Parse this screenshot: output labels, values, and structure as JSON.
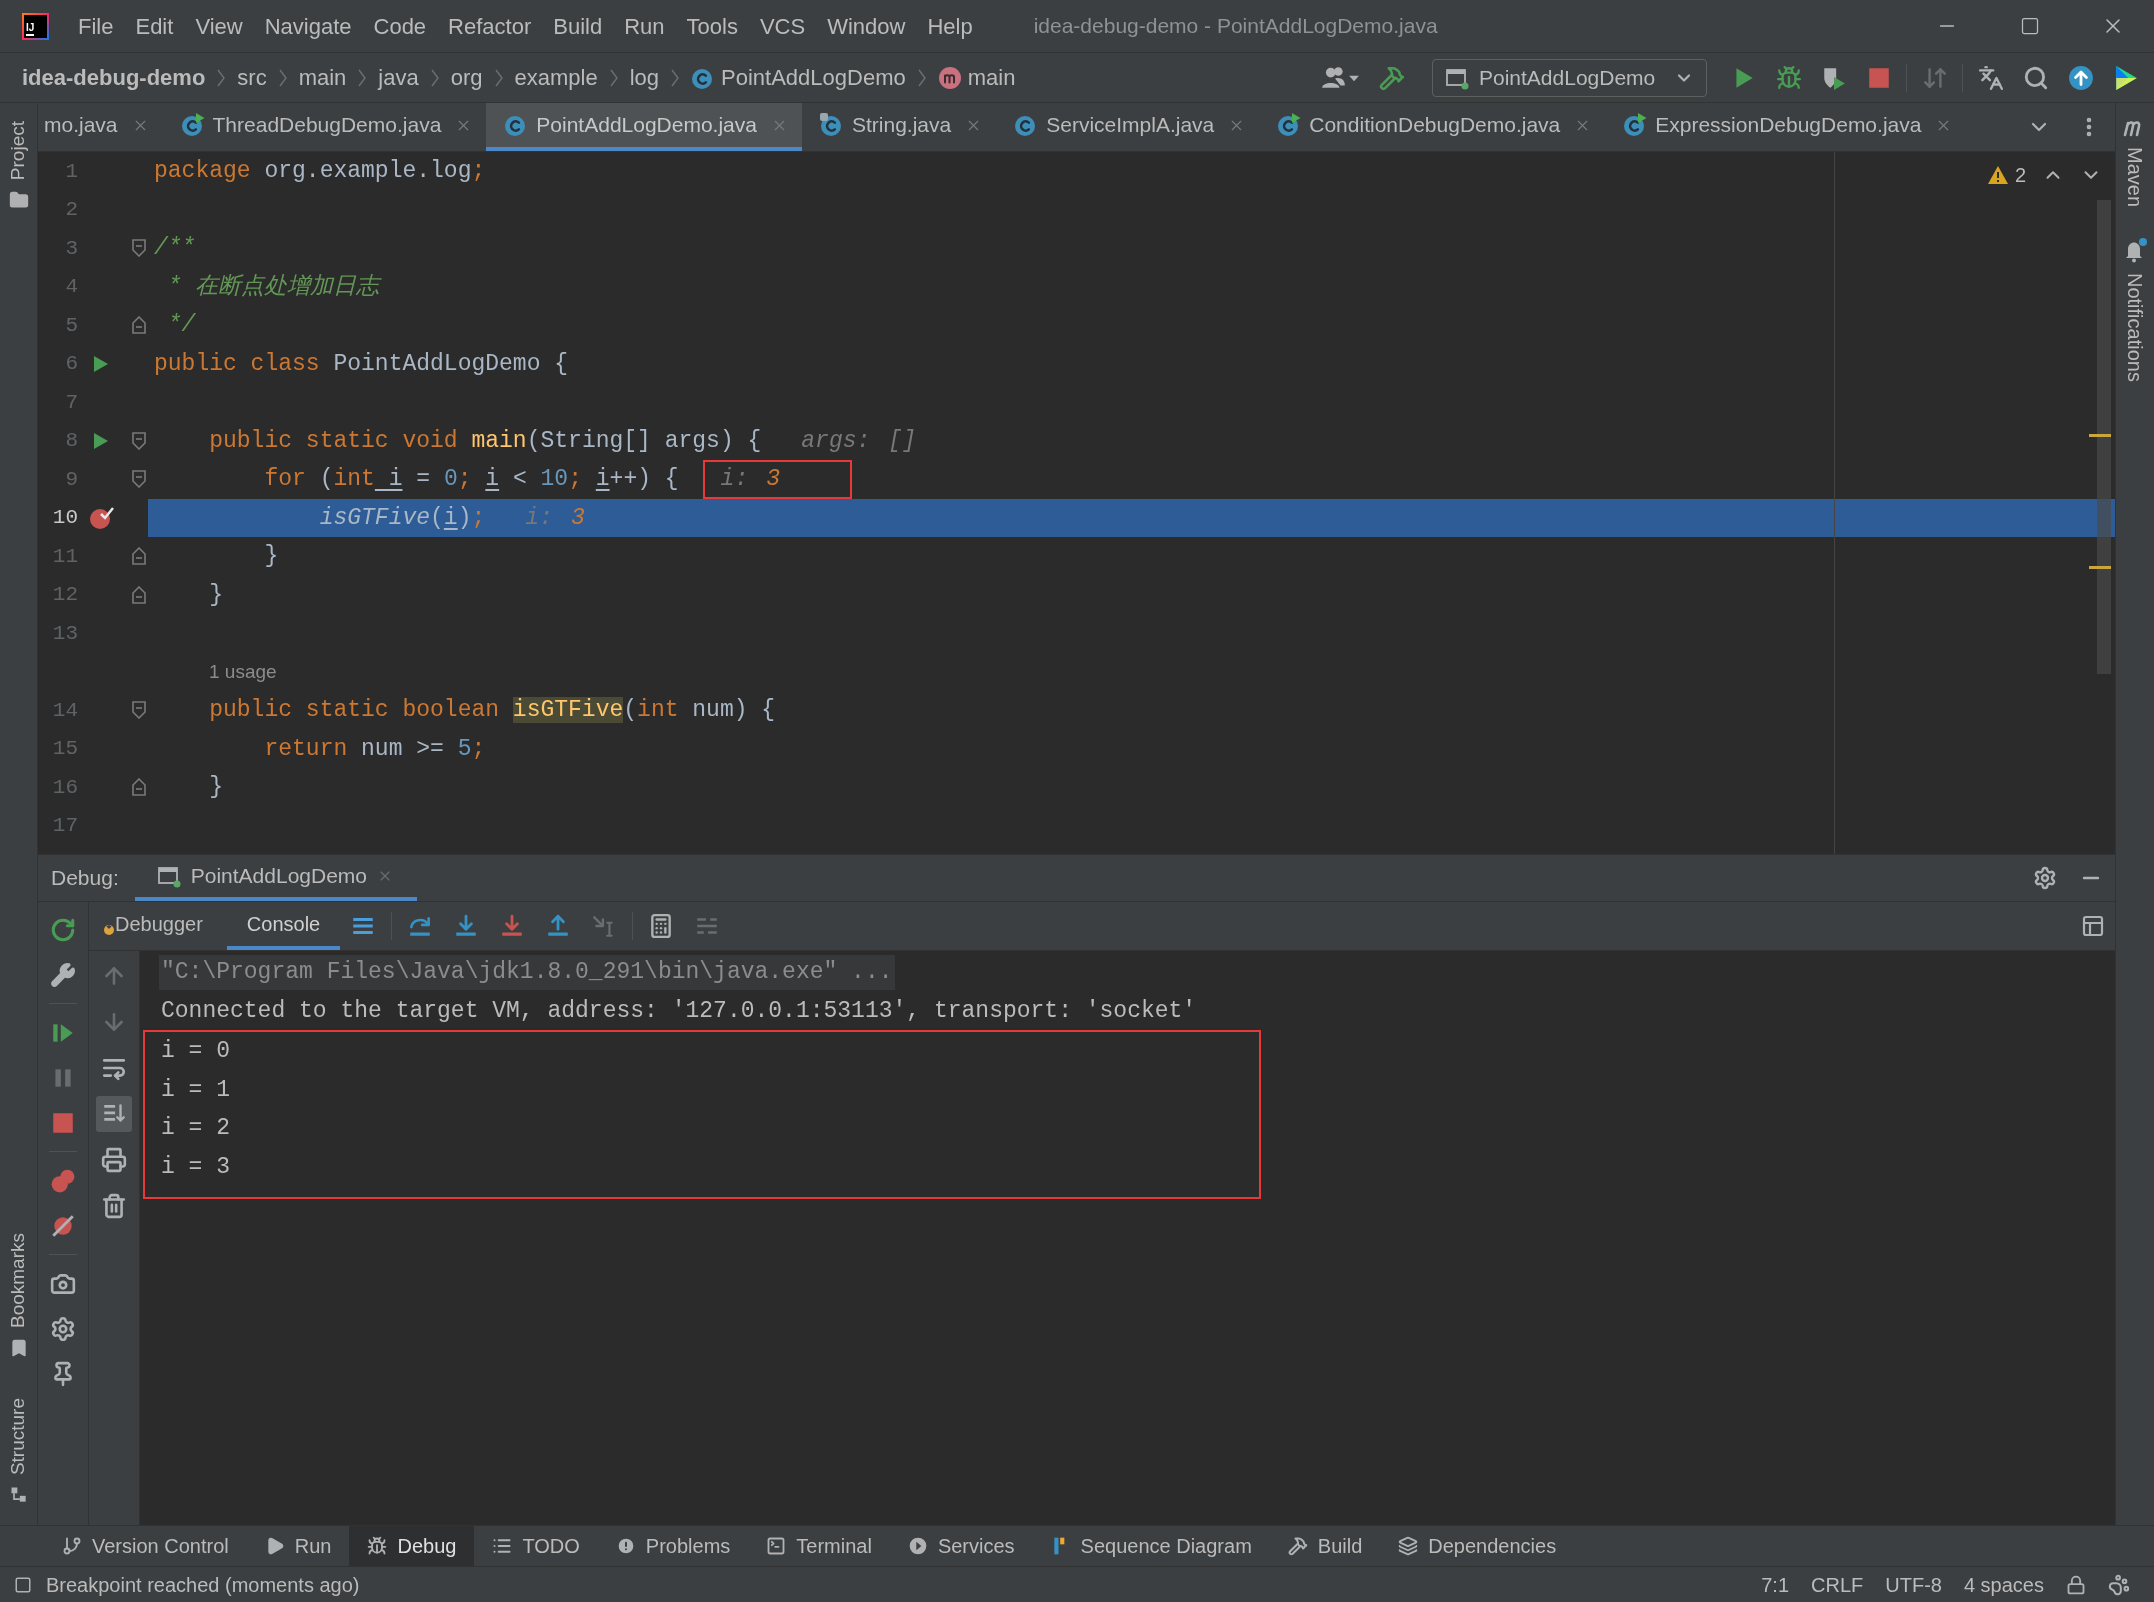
{
  "app": {
    "logo_text": "IJ"
  },
  "menu_bar": [
    "File",
    "Edit",
    "View",
    "Navigate",
    "Code",
    "Refactor",
    "Build",
    "Run",
    "Tools",
    "VCS",
    "Window",
    "Help"
  ],
  "window": {
    "title": "idea-debug-demo - PointAddLogDemo.java"
  },
  "breadcrumbs": [
    {
      "label": "idea-debug-demo",
      "kind": "project"
    },
    {
      "label": "src",
      "kind": "folder"
    },
    {
      "label": "main",
      "kind": "folder"
    },
    {
      "label": "java",
      "kind": "folder"
    },
    {
      "label": "org",
      "kind": "folder"
    },
    {
      "label": "example",
      "kind": "folder"
    },
    {
      "label": "log",
      "kind": "folder"
    },
    {
      "label": "PointAddLogDemo",
      "kind": "class"
    },
    {
      "label": "main",
      "kind": "method"
    }
  ],
  "run_toolbar": {
    "left": [
      {
        "kind": "people",
        "enabled": true
      },
      {
        "kind": "build",
        "enabled": true
      }
    ],
    "config": "PointAddLogDemo",
    "groups": [
      [
        {
          "kind": "run",
          "enabled": true
        },
        {
          "kind": "debug",
          "enabled": true
        },
        {
          "kind": "coverage",
          "enabled": true
        },
        {
          "kind": "stop",
          "enabled": true
        }
      ],
      [
        {
          "kind": "vcs",
          "enabled": false
        }
      ],
      [
        {
          "kind": "translate",
          "enabled": true
        },
        {
          "kind": "search",
          "enabled": true
        },
        {
          "kind": "update",
          "enabled": true
        },
        {
          "kind": "plugin",
          "enabled": true
        }
      ]
    ]
  },
  "editor_tabs": [
    {
      "label": "mo.java",
      "kind": "clipped",
      "selected": false
    },
    {
      "label": "ThreadDebugDemo.java",
      "kind": "runnable_class",
      "selected": false
    },
    {
      "label": "PointAddLogDemo.java",
      "kind": "class",
      "selected": true
    },
    {
      "label": "String.java",
      "kind": "library_class",
      "selected": false
    },
    {
      "label": "ServiceImplA.java",
      "kind": "class",
      "selected": false
    },
    {
      "label": "ConditionDebugDemo.java",
      "kind": "runnable_class",
      "selected": false
    },
    {
      "label": "ExpressionDebugDemo.java",
      "kind": "runnable_class",
      "selected": false
    }
  ],
  "left_stripe": {
    "top": [
      {
        "label": "Project",
        "kind": "project"
      }
    ],
    "bottom": [
      {
        "label": "Bookmarks",
        "kind": "bookmarks"
      },
      {
        "label": "Structure",
        "kind": "structure"
      }
    ]
  },
  "right_stripe": [
    {
      "label": "Maven",
      "kind": "maven",
      "unread": false
    },
    {
      "label": "Notifications",
      "kind": "notifications",
      "unread": true
    }
  ],
  "editor": {
    "warning_count": "2",
    "lines": [
      {
        "number": "1",
        "run_marker": false,
        "breakpoint": false,
        "fold_start": false,
        "fold_end": false,
        "current": false,
        "tokens": [
          {
            "text": "package",
            "kind": "keyword"
          },
          {
            "text": " org.example.log",
            "kind": "plain"
          },
          {
            "text": ";",
            "kind": "keyword"
          }
        ]
      },
      {
        "number": "2",
        "run_marker": false,
        "breakpoint": false,
        "fold_start": false,
        "fold_end": false,
        "current": false
      },
      {
        "number": "3",
        "run_marker": false,
        "breakpoint": false,
        "fold_start": true,
        "fold_end": false,
        "current": false,
        "tokens": [
          {
            "text": "/**",
            "kind": "doc"
          }
        ]
      },
      {
        "number": "4",
        "run_marker": false,
        "breakpoint": false,
        "fold_start": false,
        "fold_end": false,
        "current": false,
        "tokens": [
          {
            "text": " * 在断点处增加日志",
            "kind": "doc"
          }
        ]
      },
      {
        "number": "5",
        "run_marker": false,
        "breakpoint": false,
        "fold_start": false,
        "fold_end": true,
        "current": false,
        "tokens": [
          {
            "text": " */",
            "kind": "doc"
          }
        ]
      },
      {
        "number": "6",
        "run_marker": true,
        "breakpoint": false,
        "fold_start": false,
        "fold_end": false,
        "current": false,
        "tokens": [
          {
            "text": "public class",
            "kind": "keyword"
          },
          {
            "text": " PointAddLogDemo {",
            "kind": "plain"
          }
        ]
      },
      {
        "number": "7",
        "run_marker": false,
        "breakpoint": false,
        "fold_start": false,
        "fold_end": false,
        "current": false
      },
      {
        "number": "8",
        "run_marker": true,
        "breakpoint": false,
        "fold_start": true,
        "fold_end": false,
        "current": false,
        "tokens": [
          {
            "text": "    public static void",
            "kind": "keyword"
          },
          {
            "text": " main",
            "kind": "method_decl"
          },
          {
            "text": "(String[] args) {",
            "kind": "plain"
          }
        ],
        "hint": {
          "label": "args:",
          "value": "[]",
          "kind": "array",
          "framed": false
        }
      },
      {
        "number": "9",
        "run_marker": false,
        "breakpoint": false,
        "fold_start": true,
        "fold_end": false,
        "current": false,
        "tokens": [
          {
            "text": "        for",
            "kind": "keyword"
          },
          {
            "text": " (",
            "kind": "plain"
          },
          {
            "text": "int",
            "kind": "keyword"
          },
          {
            "text": " i",
            "kind": "reassigned_var"
          },
          {
            "text": " = ",
            "kind": "plain"
          },
          {
            "text": "0",
            "kind": "number"
          },
          {
            "text": "; ",
            "kind": "keyword"
          },
          {
            "text": "i",
            "kind": "reassigned_var"
          },
          {
            "text": " < ",
            "kind": "plain"
          },
          {
            "text": "10",
            "kind": "number"
          },
          {
            "text": "; ",
            "kind": "keyword"
          },
          {
            "text": "i",
            "kind": "reassigned_var"
          },
          {
            "text": "++) {",
            "kind": "plain"
          }
        ],
        "hint": {
          "label": "i:",
          "value": "3",
          "kind": "number",
          "framed": true
        }
      },
      {
        "number": "10",
        "run_marker": false,
        "breakpoint": true,
        "fold_start": false,
        "fold_end": false,
        "current": true,
        "tokens": [
          {
            "text": "            isGTFive",
            "kind": "static_call"
          },
          {
            "text": "(",
            "kind": "plain"
          },
          {
            "text": "i",
            "kind": "reassigned_var"
          },
          {
            "text": ")",
            "kind": "plain"
          },
          {
            "text": ";",
            "kind": "keyword"
          }
        ],
        "hint": {
          "label": "i:",
          "value": "3",
          "kind": "number",
          "framed": false
        }
      },
      {
        "number": "11",
        "run_marker": false,
        "breakpoint": false,
        "fold_start": false,
        "fold_end": true,
        "current": false,
        "tokens": [
          {
            "text": "        }",
            "kind": "plain"
          }
        ]
      },
      {
        "number": "12",
        "run_marker": false,
        "breakpoint": false,
        "fold_start": false,
        "fold_end": true,
        "current": false,
        "tokens": [
          {
            "text": "    }",
            "kind": "plain"
          }
        ]
      },
      {
        "number": "13",
        "run_marker": false,
        "breakpoint": false,
        "fold_start": false,
        "fold_end": false,
        "current": false
      },
      {
        "number": "14",
        "run_marker": false,
        "breakpoint": false,
        "fold_start": true,
        "fold_end": false,
        "current": false,
        "usage_hint": "1 usage",
        "tokens": [
          {
            "text": "    public static boolean ",
            "kind": "keyword"
          },
          {
            "text": "isGTFive",
            "kind": "method_decl_marked"
          },
          {
            "text": "(",
            "kind": "plain"
          },
          {
            "text": "int",
            "kind": "keyword"
          },
          {
            "text": " num) {",
            "kind": "plain"
          }
        ]
      },
      {
        "number": "15",
        "run_marker": false,
        "breakpoint": false,
        "fold_start": false,
        "fold_end": false,
        "current": false,
        "tokens": [
          {
            "text": "        return",
            "kind": "keyword"
          },
          {
            "text": " num >= ",
            "kind": "plain"
          },
          {
            "text": "5",
            "kind": "number"
          },
          {
            "text": ";",
            "kind": "keyword"
          }
        ]
      },
      {
        "number": "16",
        "run_marker": false,
        "breakpoint": false,
        "fold_start": false,
        "fold_end": true,
        "current": false,
        "tokens": [
          {
            "text": "    }",
            "kind": "plain"
          }
        ]
      },
      {
        "number": "17",
        "run_marker": false,
        "breakpoint": false,
        "fold_start": false,
        "fold_end": false,
        "current": false
      }
    ]
  },
  "debug": {
    "title": "Debug:",
    "session_tabs": [
      {
        "label": "PointAddLogDemo",
        "selected": true
      }
    ],
    "side_tools": [
      [
        {
          "kind": "rerun",
          "enabled": true
        },
        {
          "kind": "modify",
          "enabled": true
        }
      ],
      [
        {
          "kind": "resume",
          "enabled": true
        },
        {
          "kind": "pause",
          "enabled": false
        },
        {
          "kind": "stop",
          "enabled": true
        }
      ],
      [
        {
          "kind": "breakpoints",
          "enabled": true
        },
        {
          "kind": "mute",
          "enabled": true
        }
      ],
      [
        {
          "kind": "snapshot",
          "enabled": true
        },
        {
          "kind": "settings",
          "enabled": true
        },
        {
          "kind": "pin",
          "enabled": true
        }
      ]
    ],
    "tabs": [
      {
        "label": "Debugger",
        "selected": false
      },
      {
        "label": "Console",
        "selected": true
      }
    ],
    "step_tools": [
      [
        {
          "kind": "execution_point",
          "enabled": true
        }
      ],
      [
        {
          "kind": "step_over",
          "enabled": true
        },
        {
          "kind": "step_into",
          "enabled": true
        },
        {
          "kind": "force_step_into",
          "enabled": true
        },
        {
          "kind": "step_out",
          "enabled": true
        },
        {
          "kind": "run_to_cursor",
          "enabled": false
        }
      ],
      [
        {
          "kind": "evaluate",
          "enabled": true
        },
        {
          "kind": "trace",
          "enabled": false
        }
      ]
    ],
    "console_tools": [
      {
        "kind": "up",
        "enabled": false,
        "toggled": false
      },
      {
        "kind": "down",
        "enabled": false,
        "toggled": false
      },
      {
        "kind": "soft_wrap",
        "enabled": true,
        "toggled": false
      },
      {
        "kind": "scroll_to_end",
        "enabled": true,
        "toggled": true
      },
      {
        "kind": "print",
        "enabled": true,
        "toggled": false
      },
      {
        "kind": "clear",
        "enabled": true,
        "toggled": false
      }
    ],
    "console": {
      "lines": [
        {
          "text": "\"C:\\Program Files\\Java\\jdk1.8.0_291\\bin\\java.exe\" ...",
          "kind": "command"
        },
        {
          "text": "Connected to the target VM, address: '127.0.0.1:53113', transport: 'socket'",
          "kind": "output"
        }
      ],
      "framed_output": [
        "i = 0",
        "i = 1",
        "i = 2",
        "i = 3"
      ]
    }
  },
  "tool_windows": [
    {
      "label": "Version Control",
      "kind": "version_control",
      "selected": false
    },
    {
      "label": "Run",
      "kind": "run",
      "selected": false
    },
    {
      "label": "Debug",
      "kind": "debug",
      "selected": true
    },
    {
      "label": "TODO",
      "kind": "todo",
      "selected": false
    },
    {
      "label": "Problems",
      "kind": "problems",
      "selected": false
    },
    {
      "label": "Terminal",
      "kind": "terminal",
      "selected": false
    },
    {
      "label": "Services",
      "kind": "services",
      "selected": false
    },
    {
      "label": "Sequence Diagram",
      "kind": "sequence_diagram",
      "selected": false
    },
    {
      "label": "Build",
      "kind": "build",
      "selected": false
    },
    {
      "label": "Dependencies",
      "kind": "dependencies",
      "selected": false
    }
  ],
  "status_bar": {
    "message": "Breakpoint reached (moments ago)",
    "items": [
      "7:1",
      "CRLF",
      "UTF-8",
      "4 spaces"
    ]
  }
}
